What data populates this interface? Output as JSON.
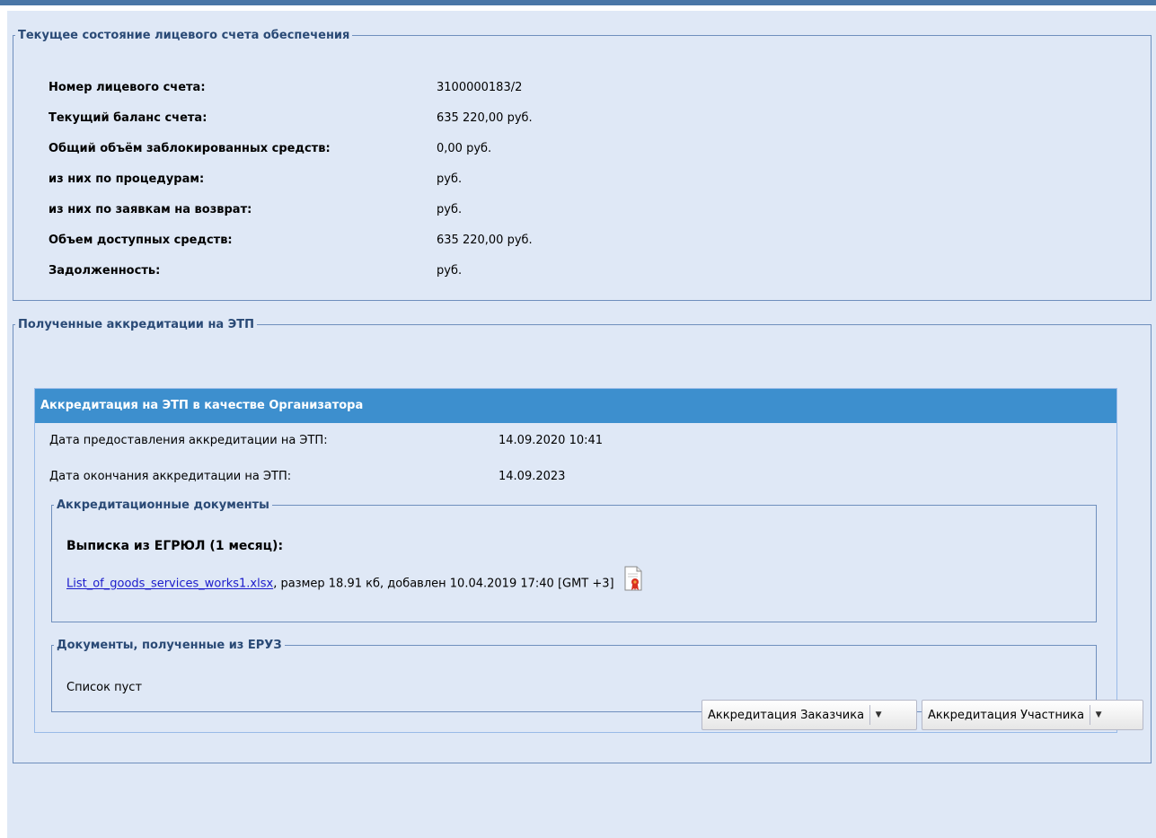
{
  "account": {
    "legend": "Текущее состояние лицевого счета обеспечения",
    "rows": [
      {
        "label": "Номер лицевого счета:",
        "value": "3100000183/2"
      },
      {
        "label": "Текущий баланс счета:",
        "value": "635 220,00 руб."
      },
      {
        "label": "Общий объём заблокированных средств:",
        "value": "0,00 руб."
      },
      {
        "label": "из них по процедурам:",
        "value": "руб."
      },
      {
        "label": "из них по заявкам на возврат:",
        "value": "руб."
      },
      {
        "label": "Объем доступных средств:",
        "value": "635 220,00 руб."
      },
      {
        "label": "Задолженность:",
        "value": "руб."
      }
    ]
  },
  "accreditations": {
    "legend": "Полученные аккредитации на ЭТП",
    "panel_title": "Аккредитация на ЭТП в качестве Организатора",
    "dates": [
      {
        "label": "Дата предоставления аккредитации на ЭТП:",
        "value": "14.09.2020 10:41"
      },
      {
        "label": "Дата окончания аккредитации на ЭТП:",
        "value": "14.09.2023"
      }
    ],
    "docs": {
      "legend": "Аккредитационные документы",
      "title": "Выписка из ЕГРЮЛ (1 месяц):",
      "file_link": "List_of_goods_services_works1.xlsx",
      "file_info": ", размер 18.91 кб, добавлен 10.04.2019 17:40 [GMT +3]",
      "icon": "signature-certificate-icon"
    },
    "eruz": {
      "legend": "Документы, полученные из ЕРУЗ",
      "empty_text": "Список пуст"
    }
  },
  "buttons": {
    "customer": "Аккредитация Заказчика",
    "participant": "Аккредитация Участника"
  },
  "colors": {
    "panel_bg": "#dfe8f6",
    "header_bg": "#3d8fce",
    "border": "#6f8fbd",
    "link": "#1a1acb"
  }
}
